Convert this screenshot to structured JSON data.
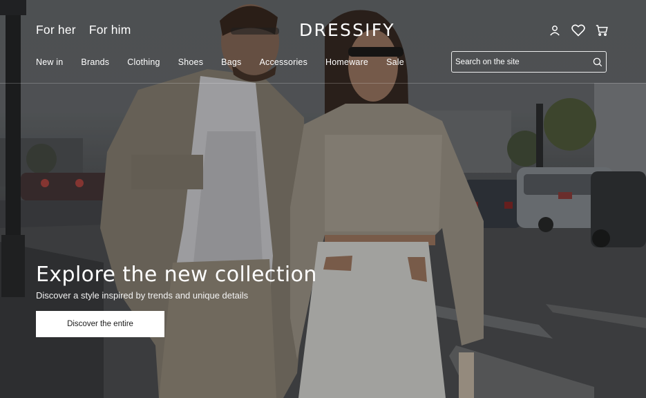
{
  "brand": {
    "logo_text": "DRESSIFY"
  },
  "gender_nav": [
    {
      "label": "For her"
    },
    {
      "label": "For him"
    }
  ],
  "main_nav": [
    {
      "label": "New in"
    },
    {
      "label": "Brands"
    },
    {
      "label": "Clothing"
    },
    {
      "label": "Shoes"
    },
    {
      "label": "Bags"
    },
    {
      "label": "Accessories"
    },
    {
      "label": "Homeware"
    },
    {
      "label": "Sale"
    }
  ],
  "search": {
    "placeholder": "Search on the site",
    "value": "",
    "icon": "search-icon"
  },
  "header_icons": [
    "user-icon",
    "heart-icon",
    "cart-icon"
  ],
  "hero": {
    "title": "Explore the new collection",
    "subtitle": "Discover a style inspired by trends and unique details",
    "cta_label": "Discover the entire"
  },
  "colors": {
    "text": "#ffffff",
    "cta_background": "#ffffff",
    "cta_text": "#1a1a1a"
  }
}
